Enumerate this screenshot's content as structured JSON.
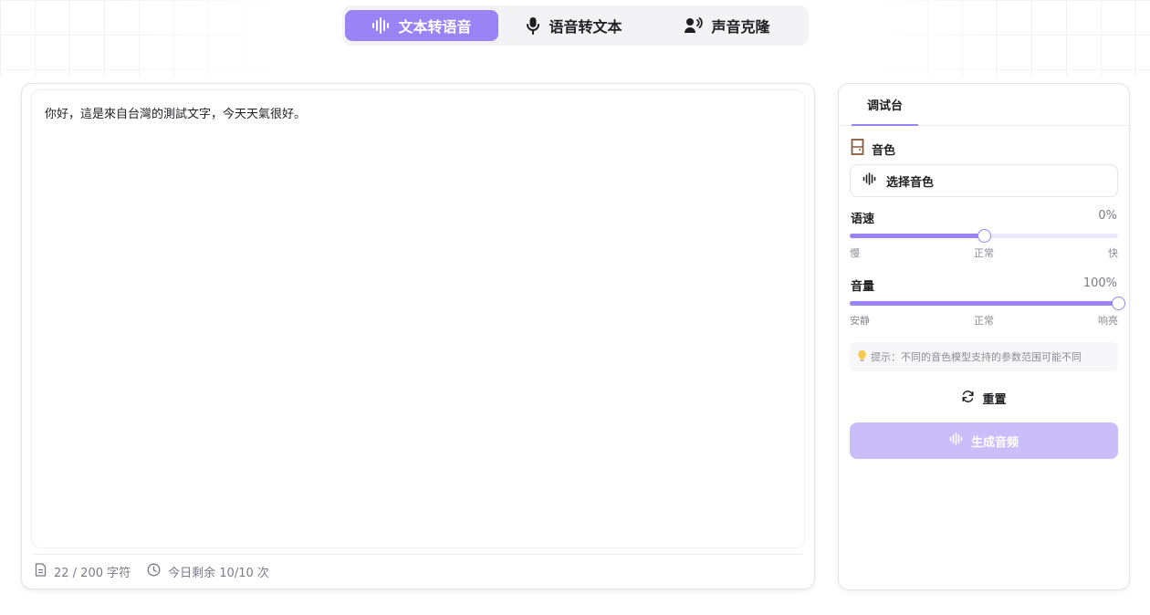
{
  "mode_tabs": [
    {
      "label": "文本转语音",
      "icon": "waveform-icon",
      "active": true
    },
    {
      "label": "语音转文本",
      "icon": "microphone-icon",
      "active": false
    },
    {
      "label": "声音克隆",
      "icon": "voice-user-icon",
      "active": false
    }
  ],
  "editor": {
    "text": "你好，這是來自台灣的測試文字，今天天氣很好。",
    "char_count": "22 / 200 字符",
    "quota": "今日剩余 10/10 次"
  },
  "panel": {
    "tab_label": "调试台",
    "voice": {
      "label": "音色",
      "select_placeholder": "选择音色"
    },
    "speed": {
      "label": "语速",
      "value": "0%",
      "level": 0.5,
      "scale": [
        "慢",
        "正常",
        "快"
      ]
    },
    "volume": {
      "label": "音量",
      "value": "100%",
      "level": 1.0,
      "scale": [
        "安静",
        "正常",
        "响亮"
      ]
    },
    "hint": "提示：不同的音色模型支持的参数范围可能不同",
    "reset_label": "重置",
    "generate_label": "生成音频"
  },
  "colors": {
    "accent": "#9a83f4",
    "accent_disabled": "#cbbdf9",
    "track": "#ece7fd"
  }
}
